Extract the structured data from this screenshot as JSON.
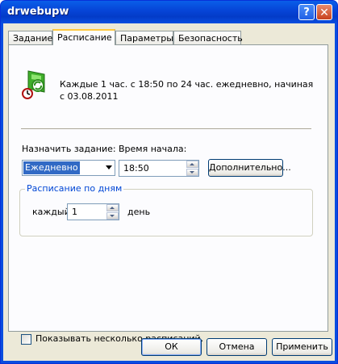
{
  "window": {
    "title": "drwebupw",
    "help_label": "?",
    "close_label": "✕"
  },
  "tabs": [
    {
      "label": "Задание",
      "active": false
    },
    {
      "label": "Расписание",
      "active": true
    },
    {
      "label": "Параметры",
      "active": false
    },
    {
      "label": "Безопасность",
      "active": false
    }
  ],
  "schedule": {
    "summary": "Каждые 1 час. с 18:50 по 24 час. ежедневно, начиная с 03.08.2011",
    "assign_label": "Назначить задание:",
    "assign_value": "Ежедневно",
    "start_time_label": "Время начала:",
    "start_time_value": "18:50",
    "advanced_button": "Дополнительно...",
    "group_caption": "Расписание по дням",
    "every_label": "каждый",
    "every_value": "1",
    "day_label": "день",
    "multiple_label": "Показывать несколько расписаний."
  },
  "buttons": {
    "ok": "ОК",
    "cancel": "Отмена",
    "apply": "Применить"
  },
  "colors": {
    "title_bar": "#0a4ddf",
    "dialog_face": "#ece9d8",
    "accent": "#316ac5"
  },
  "icons": {
    "schedule": "scheduled-task-icon"
  }
}
